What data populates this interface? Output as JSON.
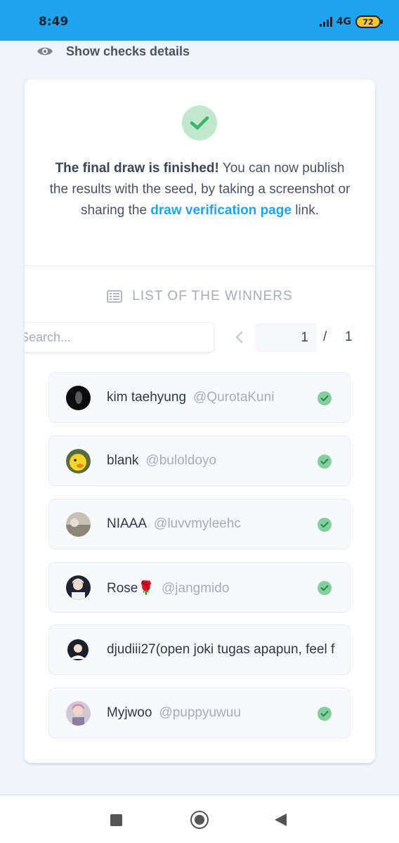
{
  "status_bar": {
    "time": "8:49",
    "network": "4G",
    "battery": "72"
  },
  "details_toggle": {
    "label": "Show checks details",
    "icon": "eye-icon"
  },
  "result": {
    "icon": "check-circle-icon",
    "bold_text": "The final draw is finished!",
    "text_1": " You can now publish the results with the seed, by taking a screenshot or sharing the ",
    "link_text": "draw verification page",
    "text_2": " link."
  },
  "winners": {
    "title": "LIST OF THE WINNERS",
    "title_icon": "list-icon",
    "search_placeholder": "Search...",
    "pagination": {
      "current_page": "1",
      "separator": "/",
      "total_pages": "1"
    },
    "items": [
      {
        "name": "kim taehyung",
        "handle": "@QurotaKuni",
        "verified": true
      },
      {
        "name": "blank",
        "handle": "@buloldoyo",
        "verified": true
      },
      {
        "name": "NIAAA",
        "handle": "@luvvmyleehc",
        "verified": true
      },
      {
        "name": "Rose🌹",
        "handle": "@jangmido",
        "verified": true
      },
      {
        "name": "djudiii27(open joki tugas apapun, feel f",
        "handle": "",
        "verified": false
      },
      {
        "name": "Myjwoo",
        "handle": "@puppyuwuu",
        "verified": true
      }
    ]
  },
  "colors": {
    "accent": "#1fa3ee",
    "success": "#84cf9e",
    "background": "#eef5fd"
  }
}
